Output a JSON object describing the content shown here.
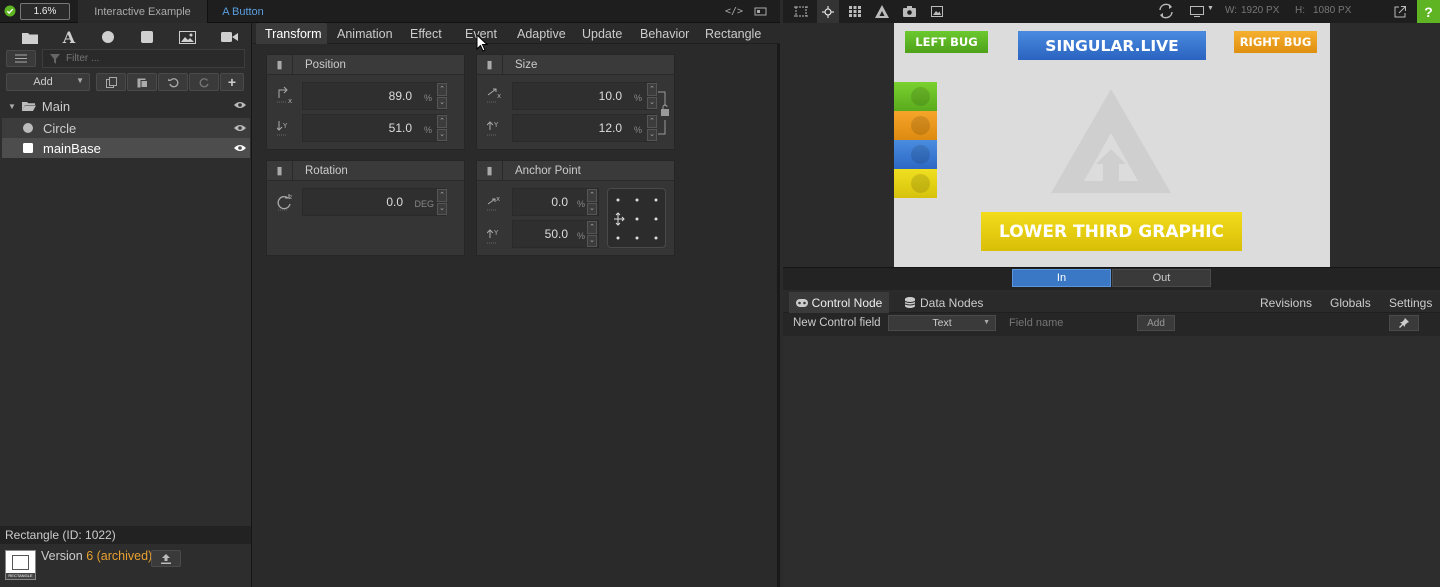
{
  "topbar": {
    "zoom": "1.6%",
    "breadcrumb": [
      "Interactive Example",
      "A Button"
    ],
    "code_icon": "</>"
  },
  "left": {
    "filter_placeholder": "Filter ...",
    "add_label": "Add",
    "tree": [
      {
        "name": "Main",
        "expanded": true
      },
      {
        "name": "Circle"
      },
      {
        "name": "mainBase",
        "selected": true
      }
    ],
    "footer_title": "Rectangle (ID: 1022)",
    "version_label": "Version",
    "version_value": "6 (archived)",
    "thumb_label": "RECTANGLE"
  },
  "tabs": [
    "Transform",
    "Animation",
    "Effect",
    "Event",
    "Adaptive",
    "Update",
    "Behavior",
    "Rectangle"
  ],
  "panels": {
    "position": {
      "title": "Position",
      "x": "89.0",
      "y": "51.0",
      "unit": "%"
    },
    "size": {
      "title": "Size",
      "w": "10.0",
      "h": "12.0",
      "unit": "%"
    },
    "rotation": {
      "title": "Rotation",
      "value": "0.0",
      "unit": "DEG"
    },
    "anchor": {
      "title": "Anchor Point",
      "x": "0.0",
      "y": "50.0",
      "unit": "%"
    }
  },
  "right": {
    "w_label": "W:",
    "w_value": "1920 PX",
    "h_label": "H:",
    "h_value": "1080 PX",
    "help": "?",
    "canvas": {
      "left_bug": "LEFT BUG",
      "title": "SINGULAR.LIVE",
      "right_bug": "RIGHT BUG",
      "lower_third": "LOWER THIRD GRAPHIC"
    },
    "in_label": "In",
    "out_label": "Out",
    "control_tabs": [
      "Control Node",
      "Data Nodes"
    ],
    "control_right": [
      "Revisions",
      "Globals",
      "Settings"
    ],
    "new_field_label": "New Control field",
    "type_select": "Text",
    "field_name_placeholder": "Field name",
    "add_button": "Add"
  },
  "colors": {
    "accent_green": "#5fb424",
    "canvas_bg": "#dcdcdc",
    "title_blue": "#2f6fd0",
    "bug_orange": "#f0a020",
    "lower_yellow": "#e8cf12",
    "in_blue": "#3a78c6"
  }
}
